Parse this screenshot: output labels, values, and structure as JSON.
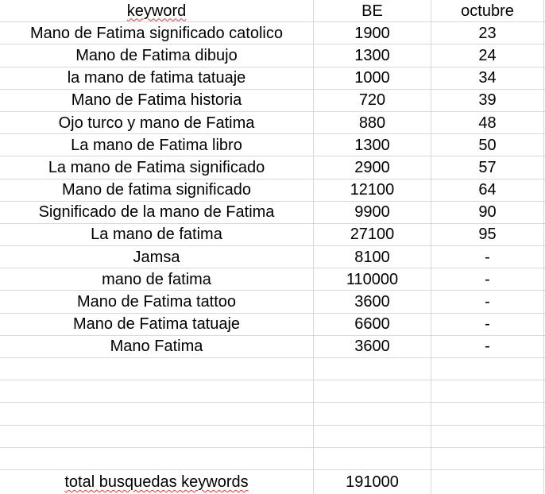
{
  "header": {
    "keyword": "keyword",
    "be": "BE",
    "octubre": "octubre"
  },
  "rows": [
    {
      "keyword": "Mano de Fatima significado catolico",
      "be": "1900",
      "octubre": "23"
    },
    {
      "keyword": "Mano de Fatima dibujo",
      "be": "1300",
      "octubre": "24"
    },
    {
      "keyword": "la mano de fatima tatuaje",
      "be": "1000",
      "octubre": "34"
    },
    {
      "keyword": "Mano de Fatima historia",
      "be": "720",
      "octubre": "39"
    },
    {
      "keyword": "Ojo turco y mano de Fatima",
      "be": "880",
      "octubre": "48"
    },
    {
      "keyword": "La mano de Fatima libro",
      "be": "1300",
      "octubre": "50"
    },
    {
      "keyword": "La mano de Fatima significado",
      "be": "2900",
      "octubre": "57"
    },
    {
      "keyword": "Mano de fatima significado",
      "be": "12100",
      "octubre": "64"
    },
    {
      "keyword": "Significado de la mano de Fatima",
      "be": "9900",
      "octubre": "90"
    },
    {
      "keyword": "La mano de fatima",
      "be": "27100",
      "octubre": "95"
    },
    {
      "keyword": "Jamsa",
      "be": "8100",
      "octubre": "-"
    },
    {
      "keyword": "mano de fatima",
      "be": "110000",
      "octubre": "-"
    },
    {
      "keyword": "Mano de Fatima tattoo",
      "be": "3600",
      "octubre": "-"
    },
    {
      "keyword": "Mano de Fatima tatuaje",
      "be": "6600",
      "octubre": "-"
    },
    {
      "keyword": "Mano Fatima",
      "be": "3600",
      "octubre": "-"
    },
    {
      "keyword": "",
      "be": "",
      "octubre": ""
    },
    {
      "keyword": "",
      "be": "",
      "octubre": ""
    },
    {
      "keyword": "",
      "be": "",
      "octubre": ""
    },
    {
      "keyword": "",
      "be": "",
      "octubre": ""
    },
    {
      "keyword": "",
      "be": "",
      "octubre": ""
    }
  ],
  "total": {
    "label": "total busquedas keywords",
    "be": "191000",
    "octubre": ""
  }
}
